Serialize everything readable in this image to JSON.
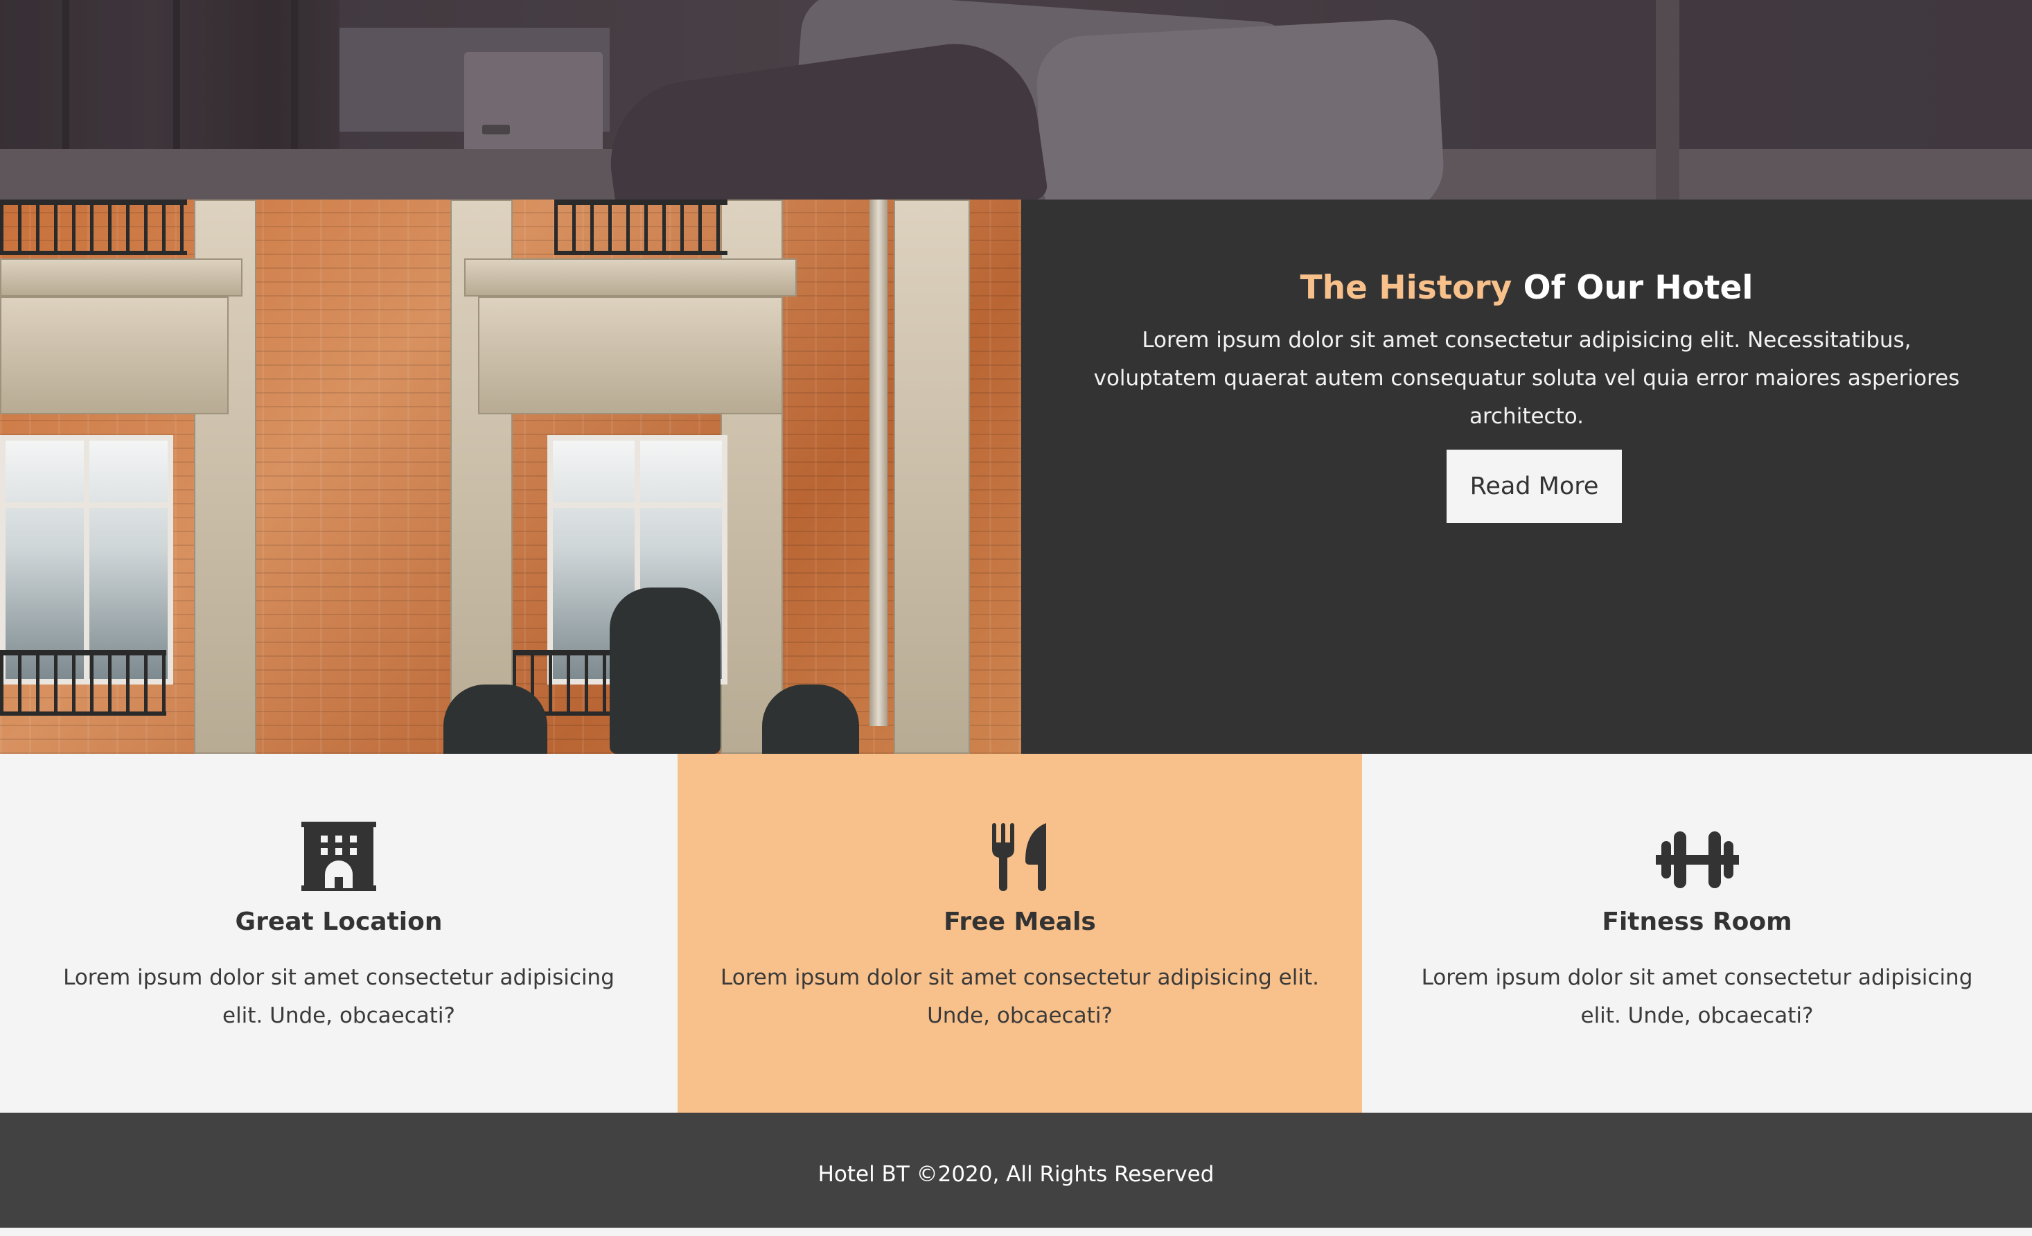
{
  "history": {
    "title_accent": "The History",
    "title_rest": "Of Our Hotel",
    "text": "Lorem ipsum dolor sit amet consectetur adipisicing elit. Necessitatibus, voluptatem quaerat autem consequatur soluta vel quia error maiores asperiores architecto.",
    "button_label": "Read More"
  },
  "features": [
    {
      "icon": "hotel-building-icon",
      "title": "Great Location",
      "text": "Lorem ipsum dolor sit amet consectetur adipisicing elit. Unde, obcaecati?",
      "background": "#f4f4f4"
    },
    {
      "icon": "utensils-icon",
      "title": "Free Meals",
      "text": "Lorem ipsum dolor sit amet consectetur adipisicing elit. Unde, obcaecati?",
      "background": "#f8c08a"
    },
    {
      "icon": "dumbbell-icon",
      "title": "Fitness Room",
      "text": "Lorem ipsum dolor sit amet consectetur adipisicing elit. Unde, obcaecati?",
      "background": "#f4f4f4"
    }
  ],
  "footer": {
    "text": "Hotel BT ©2020, All Rights Reserved"
  },
  "colors": {
    "accent": "#f8c08a",
    "dark_panel": "#333333",
    "footer": "#424242",
    "light": "#f4f4f4"
  }
}
